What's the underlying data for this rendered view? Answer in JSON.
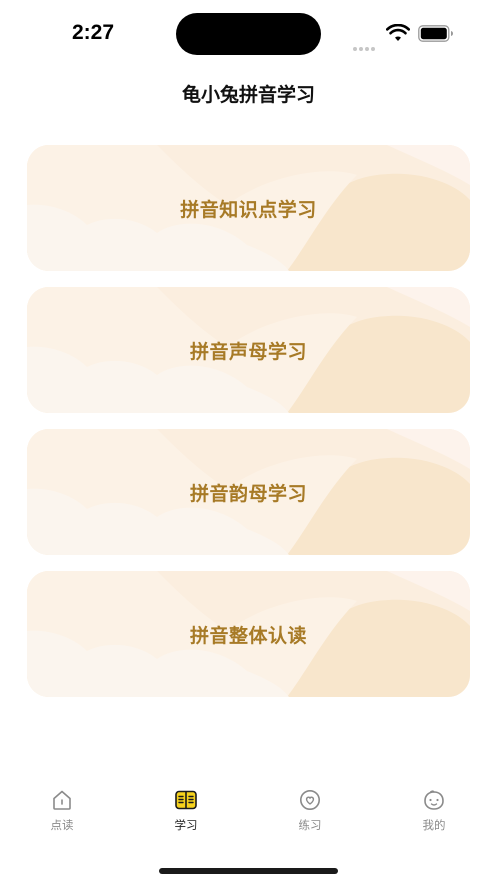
{
  "status": {
    "time": "2:27"
  },
  "nav": {
    "title": "龟小兔拼音学习"
  },
  "cards": [
    {
      "label": "拼音知识点学习"
    },
    {
      "label": "拼音声母学习"
    },
    {
      "label": "拼音韵母学习"
    },
    {
      "label": "拼音整体认读"
    }
  ],
  "tabs": [
    {
      "label": "点读",
      "icon": "home-icon",
      "active": false
    },
    {
      "label": "学习",
      "icon": "book-icon",
      "active": true
    },
    {
      "label": "练习",
      "icon": "heart-icon",
      "active": false
    },
    {
      "label": "我的",
      "icon": "face-icon",
      "active": false
    }
  ],
  "colors": {
    "card_text": "#a77a26",
    "card_bg": "#fbeede",
    "active_icon": "#f6d21c"
  }
}
